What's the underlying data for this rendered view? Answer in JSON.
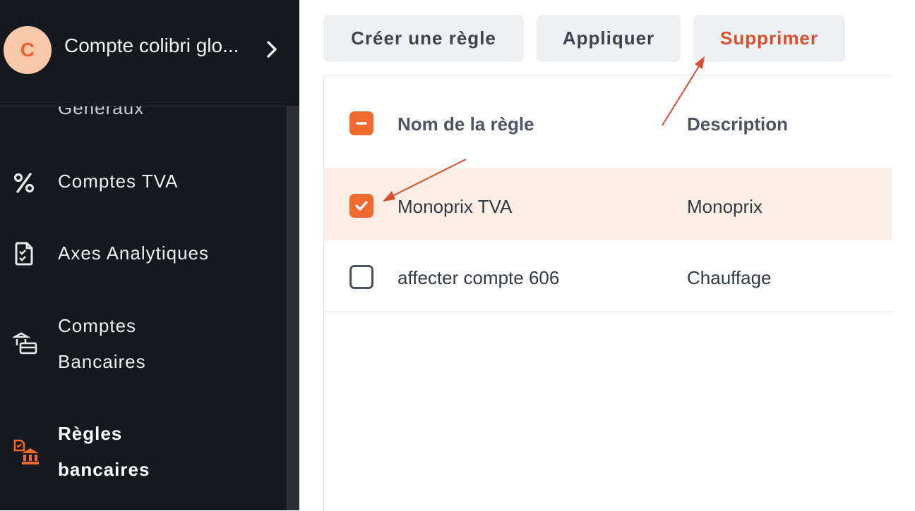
{
  "sidebar": {
    "account": {
      "initial": "C",
      "name": "Compte colibri glo..."
    },
    "partial_item": "Généraux",
    "items": [
      {
        "label": "Comptes TVA",
        "icon": "percent-icon"
      },
      {
        "label": "Axes Analytiques",
        "icon": "document-check-icon"
      },
      {
        "label_line1": "Comptes",
        "label_line2": "Bancaires",
        "icon": "bank-accounts-icon"
      },
      {
        "label_line1": "Règles",
        "label_line2": "bancaires",
        "icon": "bank-rules-icon",
        "active": true
      }
    ]
  },
  "toolbar": {
    "create_label": "Créer une règle",
    "apply_label": "Appliquer",
    "delete_label": "Supprimer"
  },
  "table": {
    "columns": [
      "Nom de la règle",
      "Description"
    ],
    "rows": [
      {
        "name": "Monoprix TVA",
        "description": "Monoprix",
        "checked": true
      },
      {
        "name": "affecter compte 606",
        "description": "Chauffage",
        "checked": false
      }
    ]
  },
  "colors": {
    "accent": "#ef6a2c",
    "danger": "#d9502f",
    "sidebar_bg": "#15181c",
    "selected_row": "#fdefe6",
    "annotation": "#d9502f"
  }
}
